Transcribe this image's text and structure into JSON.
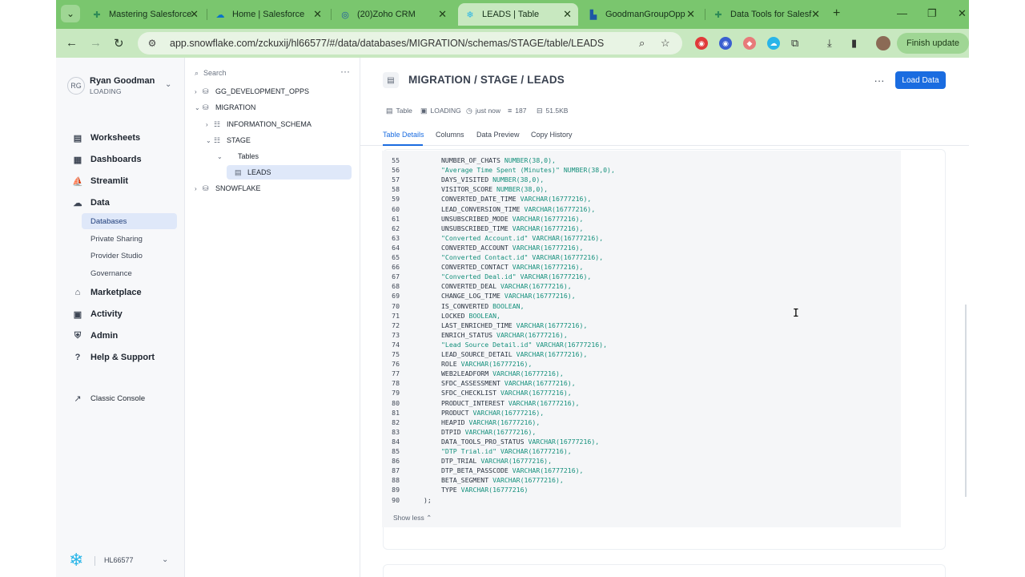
{
  "browser": {
    "tabs": [
      {
        "title": "Mastering Salesforce",
        "icon": "salesforce-green-icon"
      },
      {
        "title": "Home | Salesforce",
        "icon": "salesforce-cloud-icon"
      },
      {
        "title": "(20)Zoho CRM",
        "icon": "zoho-icon"
      },
      {
        "title": "LEADS | Table",
        "icon": "snowflake-icon",
        "active": true
      },
      {
        "title": "GoodmanGroupOpp",
        "icon": "factory-icon"
      },
      {
        "title": "Data Tools for Salesf",
        "icon": "datatools-icon"
      }
    ],
    "url": "app.snowflake.com/zckuxij/hl66577/#/data/databases/MIGRATION/schemas/STAGE/table/LEADS",
    "finish_update": "Finish update",
    "accent": "#7ac66e"
  },
  "user": {
    "initials": "RG",
    "name": "Ryan Goodman",
    "role": "LOADING"
  },
  "leftnav": {
    "items": [
      {
        "label": "Worksheets",
        "icon": "worksheet-icon"
      },
      {
        "label": "Dashboards",
        "icon": "dashboard-icon"
      },
      {
        "label": "Streamlit",
        "icon": "streamlit-icon"
      },
      {
        "label": "Data",
        "icon": "cloud-data-icon"
      }
    ],
    "data_sub": [
      {
        "label": "Databases",
        "active": true
      },
      {
        "label": "Private Sharing"
      },
      {
        "label": "Provider Studio"
      },
      {
        "label": "Governance"
      }
    ],
    "items2": [
      {
        "label": "Marketplace",
        "icon": "store-icon"
      },
      {
        "label": "Activity",
        "icon": "activity-icon"
      },
      {
        "label": "Admin",
        "icon": "shield-icon"
      },
      {
        "label": "Help & Support",
        "icon": "help-icon"
      }
    ],
    "classic": "Classic Console",
    "account": "HL66577"
  },
  "tree": {
    "search_placeholder": "Search",
    "nodes": [
      {
        "label": "GG_DEVELOPMENT_OPPS"
      },
      {
        "label": "MIGRATION"
      },
      {
        "label": "INFORMATION_SCHEMA"
      },
      {
        "label": "STAGE"
      },
      {
        "label": "Tables"
      },
      {
        "label": "LEADS"
      },
      {
        "label": "SNOWFLAKE"
      }
    ]
  },
  "main": {
    "title": "MIGRATION / STAGE / LEADS",
    "load_data": "Load Data",
    "meta": {
      "type": "Table",
      "role": "LOADING",
      "updated": "just now",
      "rows": "187",
      "size": "51.5KB"
    },
    "tabs": [
      "Table Details",
      "Columns",
      "Data Preview",
      "Copy History"
    ],
    "show_less": "Show less",
    "code_lines": [
      {
        "n": "55",
        "name": "NUMBER_OF_CHATS",
        "type": "NUMBER(38,0),"
      },
      {
        "n": "56",
        "name": "\"Average Time Spent (Minutes)\"",
        "type": "NUMBER(38,0),"
      },
      {
        "n": "57",
        "name": "DAYS_VISITED",
        "type": "NUMBER(38,0),"
      },
      {
        "n": "58",
        "name": "VISITOR_SCORE",
        "type": "NUMBER(38,0),"
      },
      {
        "n": "59",
        "name": "CONVERTED_DATE_TIME",
        "type": "VARCHAR(16777216),"
      },
      {
        "n": "60",
        "name": "LEAD_CONVERSION_TIME",
        "type": "VARCHAR(16777216),"
      },
      {
        "n": "61",
        "name": "UNSUBSCRIBED_MODE",
        "type": "VARCHAR(16777216),"
      },
      {
        "n": "62",
        "name": "UNSUBSCRIBED_TIME",
        "type": "VARCHAR(16777216),"
      },
      {
        "n": "63",
        "name": "\"Converted Account.id\"",
        "type": "VARCHAR(16777216),"
      },
      {
        "n": "64",
        "name": "CONVERTED_ACCOUNT",
        "type": "VARCHAR(16777216),"
      },
      {
        "n": "65",
        "name": "\"Converted Contact.id\"",
        "type": "VARCHAR(16777216),"
      },
      {
        "n": "66",
        "name": "CONVERTED_CONTACT",
        "type": "VARCHAR(16777216),"
      },
      {
        "n": "67",
        "name": "\"Converted Deal.id\"",
        "type": "VARCHAR(16777216),"
      },
      {
        "n": "68",
        "name": "CONVERTED_DEAL",
        "type": "VARCHAR(16777216),"
      },
      {
        "n": "69",
        "name": "CHANGE_LOG_TIME",
        "type": "VARCHAR(16777216),"
      },
      {
        "n": "70",
        "name": "IS_CONVERTED",
        "type": "BOOLEAN,"
      },
      {
        "n": "71",
        "name": "LOCKED",
        "type": "BOOLEAN,"
      },
      {
        "n": "72",
        "name": "LAST_ENRICHED_TIME",
        "type": "VARCHAR(16777216),"
      },
      {
        "n": "73",
        "name": "ENRICH_STATUS",
        "type": "VARCHAR(16777216),"
      },
      {
        "n": "74",
        "name": "\"Lead Source Detail.id\"",
        "type": "VARCHAR(16777216),"
      },
      {
        "n": "75",
        "name": "LEAD_SOURCE_DETAIL",
        "type": "VARCHAR(16777216),"
      },
      {
        "n": "76",
        "name": "ROLE",
        "type": "VARCHAR(16777216),"
      },
      {
        "n": "77",
        "name": "WEB2LEADFORM",
        "type": "VARCHAR(16777216),"
      },
      {
        "n": "78",
        "name": "SFDC_ASSESSMENT",
        "type": "VARCHAR(16777216),"
      },
      {
        "n": "79",
        "name": "SFDC_CHECKLIST",
        "type": "VARCHAR(16777216),"
      },
      {
        "n": "80",
        "name": "PRODUCT_INTEREST",
        "type": "VARCHAR(16777216),"
      },
      {
        "n": "81",
        "name": "PRODUCT",
        "type": "VARCHAR(16777216),"
      },
      {
        "n": "82",
        "name": "HEAPID",
        "type": "VARCHAR(16777216),"
      },
      {
        "n": "83",
        "name": "DTPID",
        "type": "VARCHAR(16777216),"
      },
      {
        "n": "84",
        "name": "DATA_TOOLS_PRO_STATUS",
        "type": "VARCHAR(16777216),"
      },
      {
        "n": "85",
        "name": "\"DTP Trial.id\"",
        "type": "VARCHAR(16777216),"
      },
      {
        "n": "86",
        "name": "DTP_TRIAL",
        "type": "VARCHAR(16777216),"
      },
      {
        "n": "87",
        "name": "DTP_BETA_PASSCODE",
        "type": "VARCHAR(16777216),"
      },
      {
        "n": "88",
        "name": "BETA_SEGMENT",
        "type": "VARCHAR(16777216),"
      },
      {
        "n": "89",
        "name": "TYPE",
        "type": "VARCHAR(16777216)"
      },
      {
        "n": "90",
        "name": ");",
        "type": ""
      }
    ]
  }
}
